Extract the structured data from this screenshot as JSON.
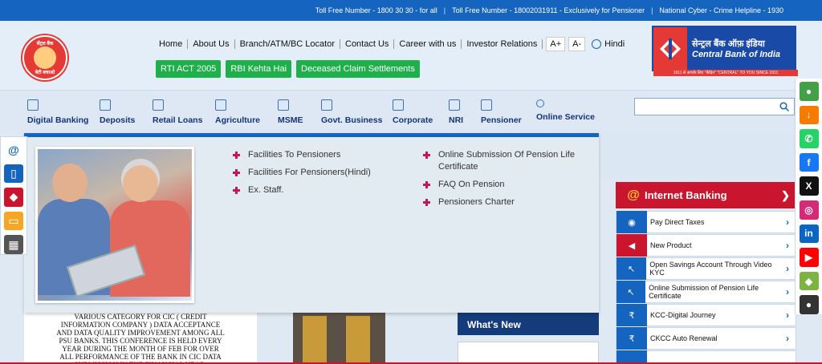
{
  "topbar": {
    "toll_free": "Toll Free Number - 1800 30 30 - for all",
    "pensioner": "Toll Free Number - 18002031911 - Exclusively for Pensioner",
    "cyber": "National Cyber - Crime Helpline - 1930"
  },
  "nav": {
    "items": [
      "Home",
      "About Us",
      "Branch/ATM/BC Locator",
      "Contact Us",
      "Career with us",
      "Investor Relations"
    ],
    "font_inc": "A+",
    "font_dec": "A-",
    "language": "Hindi"
  },
  "green_buttons": [
    "RTI ACT 2005",
    "RBI Kehta Hai",
    "Deceased Claim Settlements"
  ],
  "logo": {
    "top_text": "सेंट्रल बैंक",
    "bottom_text": "बेटी बचाओ"
  },
  "bank": {
    "name_hi": "सेन्ट्रल बैंक ऑफ़ इंडिया",
    "name_en": "Central Bank of India",
    "tagline": "1911 से आपके लिए \"केंद्रित\"  \"CENTRAL\" TO YOU SINCE 1911"
  },
  "menu": [
    "Digital Banking",
    "Deposits",
    "Retail Loans",
    "Agriculture",
    "MSME",
    "Govt. Business",
    "Corporate",
    "NRI",
    "Pensioner",
    "Online Service"
  ],
  "search": {
    "placeholder": ""
  },
  "dropdown": {
    "col1": [
      "Facilities To Pensioners",
      "Facilities For Pensioners(Hindi)",
      "Ex. Staff."
    ],
    "col2": [
      "Online Submission Of Pension Life Certificate",
      "FAQ On Pension",
      "Pensioners Charter"
    ]
  },
  "behind": {
    "paragraph": "VARIOUS CATEGORY FOR CIC ( CREDIT INFORMATION COMPANY ) DATA ACCEPTANCE AND DATA QUALITY IMPROVEMENT AMONG ALL PSU BANKS. THIS CONFERENCE IS HELD EVERY YEAR DURING THE MONTH OF FEB FOR OVER ALL PERFORMANCE OF THE BANK IN CIC DATA SUBMISSION IN THE FINANCIAL YEAR.",
    "whats_new": "What's New"
  },
  "internet_banking": "Internet Banking",
  "services": [
    "Pay Direct Taxes",
    "New Product",
    "Open Savings Account Through Video KYC",
    "Online Submission of Pension Life Certificate",
    "KCC-Digital Journey",
    "CKCC Auto Renewal"
  ],
  "colors": {
    "primary": "#1565c0",
    "accent": "#c9152d",
    "green": "#20b04b"
  }
}
